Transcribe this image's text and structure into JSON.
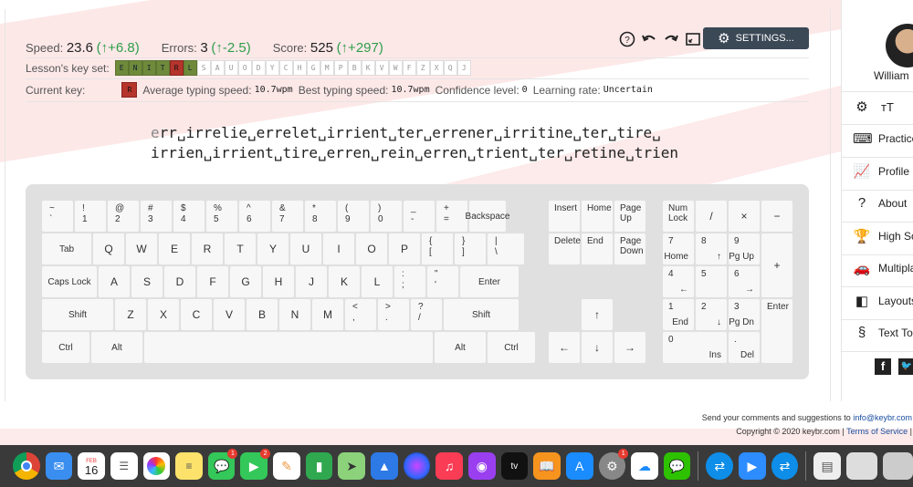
{
  "stats": {
    "speed_label": "Speed:",
    "speed_value": "23.6",
    "speed_delta": "(↑+6.8)",
    "errors_label": "Errors:",
    "errors_value": "3",
    "errors_delta": "(↑-2.5)",
    "score_label": "Score:",
    "score_value": "525",
    "score_delta": "(↑+297)"
  },
  "toolbar": {
    "settings_label": "SETTINGS..."
  },
  "lesson": {
    "keyset_label": "Lesson's key set:",
    "keys": [
      {
        "k": "E",
        "state": "done"
      },
      {
        "k": "N",
        "state": "done"
      },
      {
        "k": "I",
        "state": "done"
      },
      {
        "k": "T",
        "state": "done"
      },
      {
        "k": "R",
        "state": "cur"
      },
      {
        "k": "L",
        "state": "done"
      },
      {
        "k": "S",
        "state": "todo"
      },
      {
        "k": "A",
        "state": "todo"
      },
      {
        "k": "U",
        "state": "todo"
      },
      {
        "k": "O",
        "state": "todo"
      },
      {
        "k": "D",
        "state": "todo"
      },
      {
        "k": "Y",
        "state": "todo"
      },
      {
        "k": "C",
        "state": "todo"
      },
      {
        "k": "H",
        "state": "todo"
      },
      {
        "k": "G",
        "state": "todo"
      },
      {
        "k": "M",
        "state": "todo"
      },
      {
        "k": "P",
        "state": "todo"
      },
      {
        "k": "B",
        "state": "todo"
      },
      {
        "k": "K",
        "state": "todo"
      },
      {
        "k": "V",
        "state": "todo"
      },
      {
        "k": "W",
        "state": "todo"
      },
      {
        "k": "F",
        "state": "todo"
      },
      {
        "k": "Z",
        "state": "todo"
      },
      {
        "k": "X",
        "state": "todo"
      },
      {
        "k": "Q",
        "state": "todo"
      },
      {
        "k": "J",
        "state": "todo"
      }
    ],
    "current_key_label": "Current key:",
    "current_key": "R",
    "avg_speed_label": "Average typing speed:",
    "avg_speed": "10.7wpm",
    "best_speed_label": "Best typing speed:",
    "best_speed": "10.7wpm",
    "confidence_label": "Confidence level:",
    "confidence": "0",
    "rate_label": "Learning rate:",
    "rate": "Uncertain"
  },
  "practice_text": {
    "first_char": "e",
    "line1_rest": "rr␣irrelie␣errelet␣irrient␣ter␣errener␣irritine␣ter␣tire␣",
    "line2": "irrien␣irrient␣tire␣erren␣rein␣erren␣trient␣ter␣retine␣trien"
  },
  "keyboard": {
    "row1": [
      {
        "top": "~",
        "bot": "`"
      },
      {
        "top": "!",
        "bot": "1"
      },
      {
        "top": "@",
        "bot": "2"
      },
      {
        "top": "#",
        "bot": "3"
      },
      {
        "top": "$",
        "bot": "4"
      },
      {
        "top": "%",
        "bot": "5"
      },
      {
        "top": "^",
        "bot": "6"
      },
      {
        "top": "&",
        "bot": "7"
      },
      {
        "top": "*",
        "bot": "8"
      },
      {
        "top": "(",
        "bot": "9"
      },
      {
        "top": ")",
        "bot": "0"
      },
      {
        "top": "_",
        "bot": "-"
      },
      {
        "top": "+",
        "bot": "="
      }
    ],
    "backspace": "Backspace",
    "tab": "Tab",
    "row2": [
      "Q",
      "W",
      "E",
      "R",
      "T",
      "Y",
      "U",
      "I",
      "O",
      "P"
    ],
    "row2_sym": [
      {
        "top": "{",
        "bot": "["
      },
      {
        "top": "}",
        "bot": "]"
      },
      {
        "top": "|",
        "bot": "\\"
      }
    ],
    "caps": "Caps Lock",
    "row3": [
      "A",
      "S",
      "D",
      "F",
      "G",
      "H",
      "J",
      "K",
      "L"
    ],
    "row3_sym": [
      {
        "top": ":",
        "bot": ";"
      },
      {
        "top": "\"",
        "bot": "'"
      }
    ],
    "enter": "Enter",
    "shift": "Shift",
    "row4": [
      "Z",
      "X",
      "C",
      "V",
      "B",
      "N",
      "M"
    ],
    "row4_sym": [
      {
        "top": "<",
        "bot": ","
      },
      {
        "top": ">",
        "bot": "."
      },
      {
        "top": "?",
        "bot": "/"
      }
    ],
    "ctrl": "Ctrl",
    "alt": "Alt",
    "insert": "Insert",
    "home": "Home",
    "pageup": "Page Up",
    "delete": "Delete",
    "end": "End",
    "pagedown": "Page Down",
    "arrow_up": "↑",
    "arrow_left": "←",
    "arrow_down": "↓",
    "arrow_right": "→",
    "numlock": "Num Lock",
    "slash": "/",
    "mult": "×",
    "minus": "−",
    "plus": "+",
    "np7": "7",
    "np7s": "Home",
    "np8": "8",
    "np8s": "↑",
    "np9": "9",
    "np9s": "Pg Up",
    "np4": "4",
    "np4s": "←",
    "np5": "5",
    "np6": "6",
    "np6s": "→",
    "np1": "1",
    "np1s": "End",
    "np2": "2",
    "np2s": "↓",
    "np3": "3",
    "np3s": "Pg Dn",
    "np0": "0",
    "np0s": "Ins",
    "npdot": ".",
    "npdots": "Del",
    "npenter": "Enter"
  },
  "sidebar": {
    "username": "William",
    "items": [
      "Practice",
      "Profile",
      "About",
      "High Sc",
      "Multipla",
      "Layouts",
      "Text Too"
    ]
  },
  "footer": {
    "comments": "Send your comments and suggestions to",
    "email": "info@keybr.com",
    "copyright": "Copyright © 2020 keybr.com |",
    "tos": "Terms of Service",
    "tail": "|"
  },
  "dock": {
    "calendar_month": "FEB",
    "calendar_day": "16",
    "badge_messages": "1",
    "badge_facetime": "2",
    "badge_prefs": "1",
    "appletv": "tv"
  }
}
